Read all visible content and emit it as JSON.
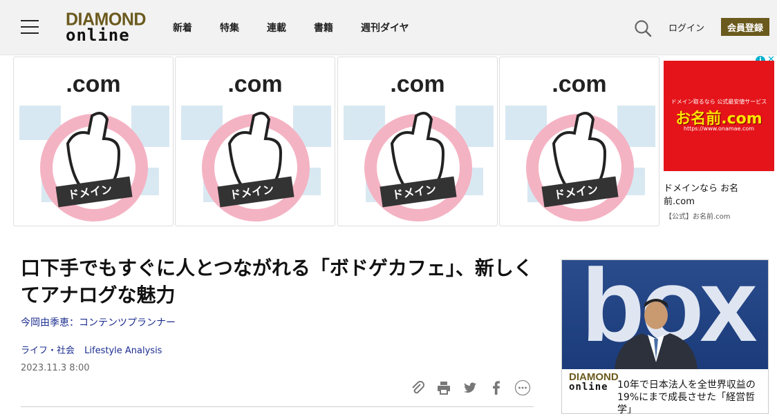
{
  "header": {
    "logo_line1": "DIAMOND",
    "logo_line2": "online",
    "nav": [
      "新着",
      "特集",
      "連載",
      "書籍",
      "週刊ダイヤ"
    ],
    "login": "ログイン",
    "register": "会員登録",
    "brand_color": "#6b5a1e"
  },
  "ads": {
    "tiles": [
      {
        "domain_text": ".com",
        "ribbon": "ドメイン"
      },
      {
        "domain_text": ".com",
        "ribbon": "ドメイン"
      },
      {
        "domain_text": ".com",
        "ribbon": "ドメイン"
      },
      {
        "domain_text": ".com",
        "ribbon": "ドメイン"
      }
    ],
    "side_banner": {
      "line1": "ドメイン取るなら 公式最安値サービス",
      "line2": "お名前.com",
      "line3": "https://www.onamae.com"
    },
    "side_title": "ドメインなら お名前.com",
    "side_source": "【公式】お名前.com"
  },
  "article": {
    "title": "口下手でもすぐに人とつながれる「ボドゲカフェ」、新しくてアナログな魅力",
    "author": "今岡由季恵：コンテンツプランナー",
    "categories": [
      "ライフ・社会",
      "Lifestyle Analysis"
    ],
    "date": "2023.11.3 8:00"
  },
  "share_icons": [
    "clip-icon",
    "print-icon",
    "twitter-icon",
    "facebook-icon",
    "more-icon"
  ],
  "promo": {
    "logo_line1": "DIAMOND",
    "logo_line2": "online",
    "image_text": "box",
    "text": "10年で日本法人を全世界収益の19%にまで成長させた「経営哲学」"
  }
}
